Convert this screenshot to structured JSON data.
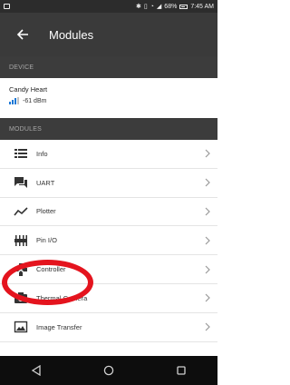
{
  "status_bar": {
    "battery": "68%",
    "time": "7:45 AM",
    "icons": [
      "notification-icon",
      "bluetooth-icon",
      "vibrate-icon",
      "wifi-icon",
      "signal-icon",
      "battery-icon"
    ]
  },
  "app_bar": {
    "title": "Modules",
    "back_icon": "arrow-left-icon"
  },
  "device_section": {
    "header": "DEVICE"
  },
  "device": {
    "name": "Candy Heart",
    "rssi": "-61 dBm",
    "signal_level": 0.75
  },
  "modules_section": {
    "header": "MODULES"
  },
  "modules": [
    {
      "label": "Info",
      "icon": "list-icon"
    },
    {
      "label": "UART",
      "icon": "chat-icon"
    },
    {
      "label": "Plotter",
      "icon": "line-chart-icon"
    },
    {
      "label": "Pin I/O",
      "icon": "pins-icon"
    },
    {
      "label": "Controller",
      "icon": "gamepad-icon"
    },
    {
      "label": "Thermal Camera",
      "icon": "camera-icon"
    },
    {
      "label": "Image Transfer",
      "icon": "image-icon"
    }
  ],
  "nav_bar": {
    "icons": [
      "back-triangle-icon",
      "home-circle-icon",
      "recents-square-icon"
    ]
  },
  "colors": {
    "accent_signal": "#1c78d6",
    "highlight_ring": "#e4141e",
    "app_bar": "#3a3a3a",
    "section_header": "#3c3c3c"
  }
}
